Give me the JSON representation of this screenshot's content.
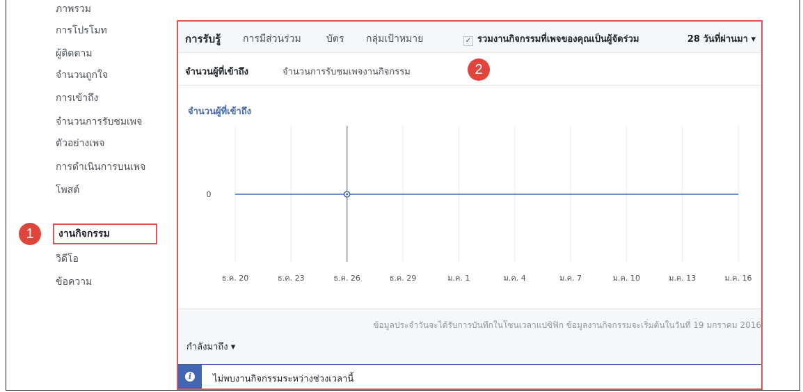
{
  "sidebar": {
    "items": [
      {
        "label": "ภาพรวม"
      },
      {
        "label": "การโปรโมท"
      },
      {
        "label": "ผู้ติดตาม"
      },
      {
        "label": "จำนวนถูกใจ"
      },
      {
        "label": "การเข้าถึง"
      },
      {
        "label": "จำนวนการรับชมเพจ"
      },
      {
        "label": "ตัวอย่างเพจ"
      },
      {
        "label": "การดำเนินการบนเพจ"
      },
      {
        "label": "โพสต์"
      },
      {
        "label": "งานกิจกรรม"
      },
      {
        "label": "วิดีโอ"
      },
      {
        "label": "ข้อความ"
      }
    ],
    "active_index": 9
  },
  "badges": {
    "one": "1",
    "two": "2"
  },
  "tabs_primary": [
    {
      "label": "การรับรู้"
    },
    {
      "label": "การมีส่วนร่วม"
    },
    {
      "label": "บัตร"
    },
    {
      "label": "กลุ่มเป้าหมาย"
    }
  ],
  "co_host_checkbox": {
    "label": "รวมงานกิจกรรมที่เพจของคุณเป็นผู้จัดร่วม",
    "checked": true,
    "check_glyph": "✓"
  },
  "period_dropdown": {
    "label": "28 วันที่ผ่านมา ▾"
  },
  "tabs_secondary": [
    {
      "label": "จำนวนผู้ที่เข้าถึง"
    },
    {
      "label": "จำนวนการรับชมเพจงานกิจกรรม"
    }
  ],
  "chart_data": {
    "type": "line",
    "title": "จำนวนผู้ที่เข้าถึง",
    "x": [
      "ธ.ค. 20",
      "ธ.ค. 23",
      "ธ.ค. 26",
      "ธ.ค. 29",
      "ม.ค. 1",
      "ม.ค. 4",
      "ม.ค. 7",
      "ม.ค. 10",
      "ม.ค. 13",
      "ม.ค. 16"
    ],
    "series": [
      {
        "values": [
          0,
          0,
          0,
          0,
          0,
          0,
          0,
          0,
          0,
          0
        ]
      }
    ],
    "y_ticks": [
      "0"
    ],
    "highlight_x": "ธ.ค. 26",
    "grid": true,
    "line_color": "#4267b2"
  },
  "footer": {
    "note": "ข้อมูลประจำวันจะได้รับการบันทึกในโซนเวลาแปซิฟิก ข้อมูลงานกิจกรรมจะเริ่มต้นในวันที่ 19 มกราคม 2016",
    "incoming_label": "กำลังมาถึง ▾"
  },
  "info_banner": {
    "text": "ไม่พบงานกิจกรรมระหว่างช่วงเวลานี้",
    "icon_glyph": "i"
  },
  "colors": {
    "accent": "#4267b2",
    "highlight": "#e05454"
  }
}
